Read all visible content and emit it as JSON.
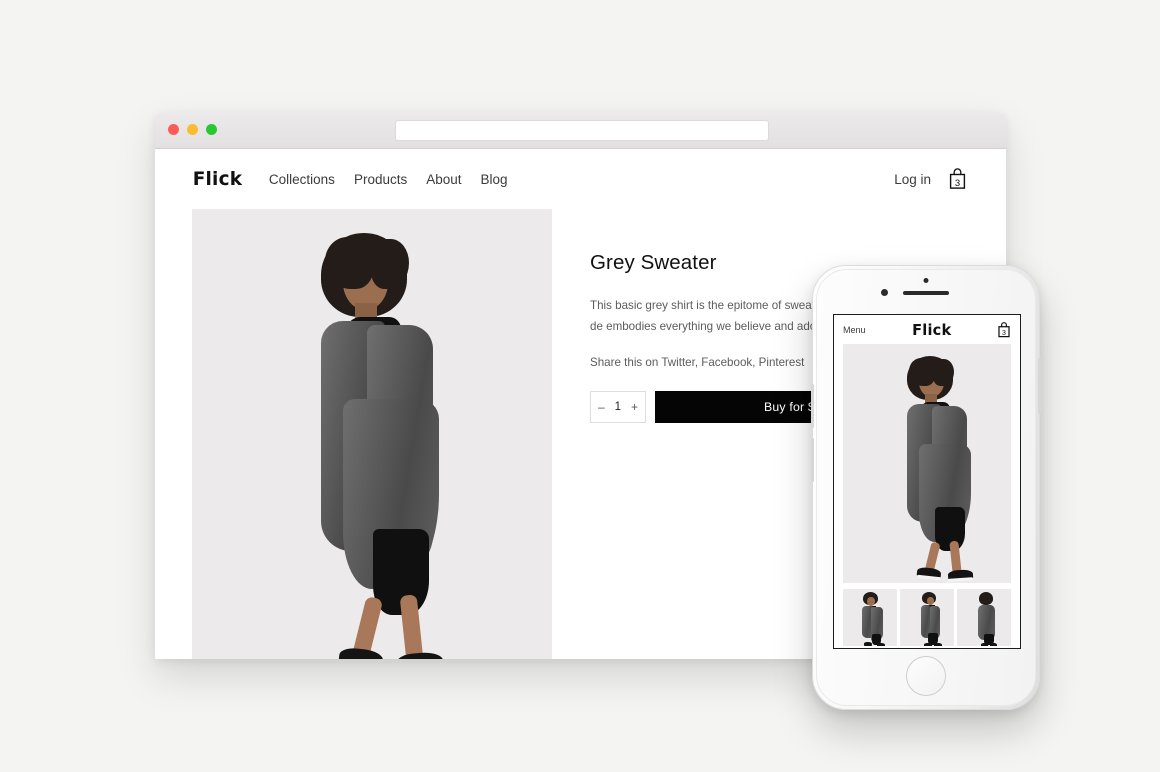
{
  "browser": {
    "traffic_lights": [
      {
        "name": "close",
        "color": "#fc5b57"
      },
      {
        "name": "minimize",
        "color": "#f9bd2f"
      },
      {
        "name": "maximize",
        "color": "#2ac734"
      }
    ],
    "url_value": "",
    "url_placeholder": ""
  },
  "site": {
    "logo": "Flick",
    "nav": [
      {
        "label": "Collections"
      },
      {
        "label": "Products"
      },
      {
        "label": "About"
      },
      {
        "label": "Blog"
      }
    ],
    "login_label": "Log in",
    "cart_icon": "shopping-bag-icon",
    "cart_count": "3"
  },
  "product": {
    "title": "Grey Sweater",
    "description": "This basic grey shirt is the epitome of sweater de  embodies everything we believe and adore.",
    "share_text": "Share this on Twitter, Facebook, Pinterest",
    "qty_minus": "–",
    "qty_value": "1",
    "qty_plus": "+",
    "buy_label": "Buy for $"
  },
  "mobile": {
    "menu_label": "Menu",
    "logo": "Flick",
    "cart_icon": "shopping-bag-icon",
    "cart_count": "3",
    "thumbnails": [
      {
        "name": "thumb-walking-left"
      },
      {
        "name": "thumb-side-view"
      },
      {
        "name": "thumb-back-view"
      }
    ]
  },
  "colors": {
    "page_background": "#f4f4f3",
    "accent_black": "#050505",
    "image_background": "#eceaea",
    "text_primary": "#111111",
    "text_secondary": "#5c5c5c"
  }
}
